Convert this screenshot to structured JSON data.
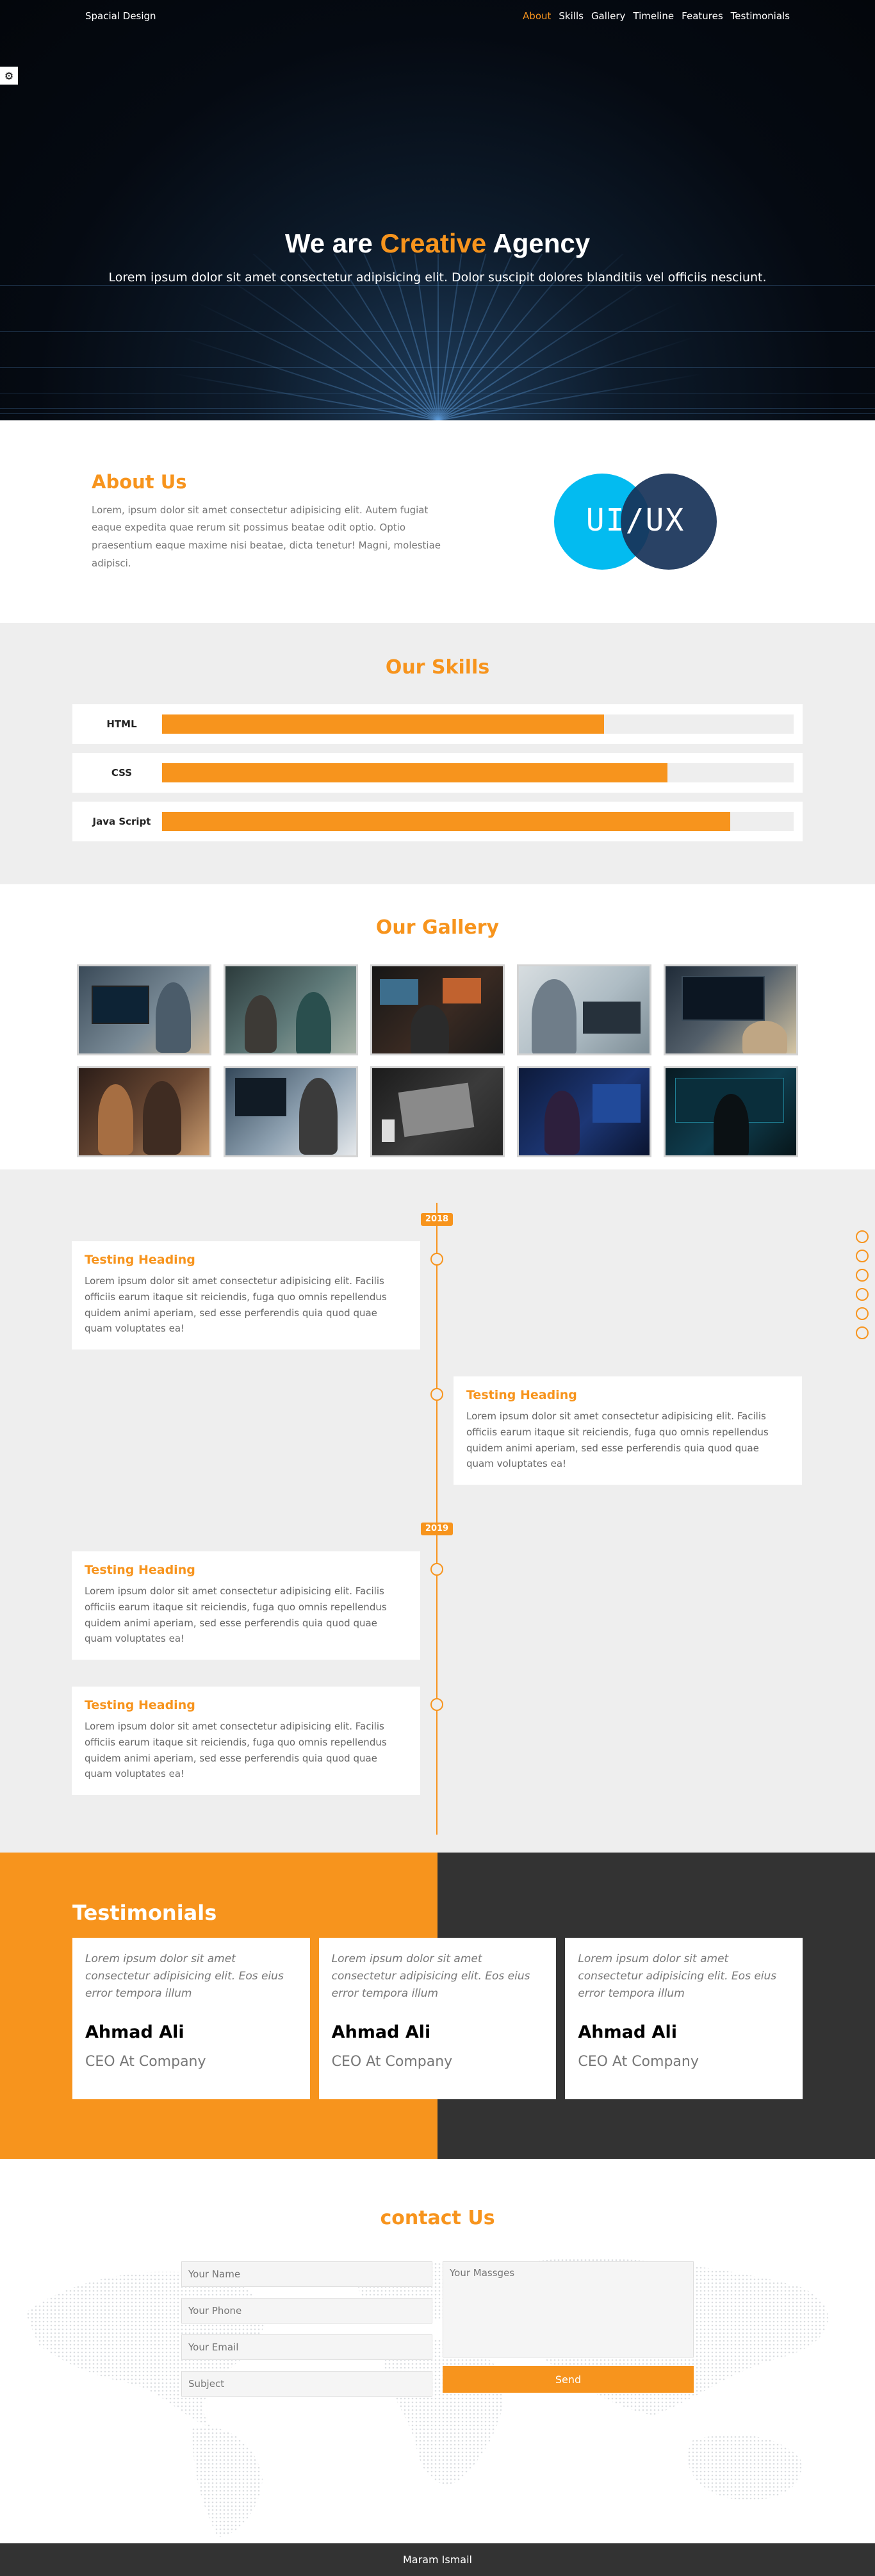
{
  "nav": {
    "logo": "Spacial Design",
    "links": [
      "About",
      "Skills",
      "Gallery",
      "Timeline",
      "Features",
      "Testimonials"
    ]
  },
  "settings": {
    "icon": "gear-icon"
  },
  "landing": {
    "title_before": "We are",
    "title_highlight": "Creative",
    "title_after": "Agency",
    "subtitle": "Lorem ipsum dolor sit amet consectetur adipisicing elit. Dolor suscipit dolores blanditiis vel officiis nesciunt."
  },
  "about": {
    "title": "About Us",
    "text": "Lorem, ipsum dolor sit amet consectetur adipisicing elit. Autem fugiat eaque expedita quae rerum sit possimus beatae odit optio. Optio praesentium eaque maxime nisi beatae, dicta tenetur! Magni, molestiae adipisci.",
    "image_text": "UI/UX"
  },
  "skills": {
    "title": "Our Skills",
    "items": [
      {
        "name": "HTML",
        "progress": 70
      },
      {
        "name": "CSS",
        "progress": 80
      },
      {
        "name": "Java Script",
        "progress": 90
      }
    ]
  },
  "gallery": {
    "title": "Our Gallery"
  },
  "timeline": {
    "years": [
      "2018",
      "2019"
    ],
    "items": [
      {
        "heading": "Testing Heading",
        "text": "Lorem ipsum dolor sit amet consectetur adipisicing elit. Facilis officiis earum itaque sit reiciendis, fuga quo omnis repellendus quidem animi aperiam, sed esse perferendis quia quod quae quam voluptates ea!"
      },
      {
        "heading": "Testing Heading",
        "text": "Lorem ipsum dolor sit amet consectetur adipisicing elit. Facilis officiis earum itaque sit reiciendis, fuga quo omnis repellendus quidem animi aperiam, sed esse perferendis quia quod quae quam voluptates ea!"
      },
      {
        "heading": "Testing Heading",
        "text": "Lorem ipsum dolor sit amet consectetur adipisicing elit. Facilis officiis earum itaque sit reiciendis, fuga quo omnis repellendus quidem animi aperiam, sed esse perferendis quia quod quae quam voluptates ea!"
      },
      {
        "heading": "Testing Heading",
        "text": "Lorem ipsum dolor sit amet consectetur adipisicing elit. Facilis officiis earum itaque sit reiciendis, fuga quo omnis repellendus quidem animi aperiam, sed esse perferendis quia quod quae quam voluptates ea!"
      }
    ]
  },
  "testimonials": {
    "title": "Testimonials",
    "items": [
      {
        "quote": "Lorem ipsum dolor sit amet consectetur adipisicing elit. Eos eius error tempora illum",
        "name": "Ahmad Ali",
        "title": "CEO At Company"
      },
      {
        "quote": "Lorem ipsum dolor sit amet consectetur adipisicing elit. Eos eius error tempora illum",
        "name": "Ahmad Ali",
        "title": "CEO At Company"
      },
      {
        "quote": "Lorem ipsum dolor sit amet consectetur adipisicing elit. Eos eius error tempora illum",
        "name": "Ahmad Ali",
        "title": "CEO At Company"
      }
    ]
  },
  "contact": {
    "title": "contact Us",
    "name_placeholder": "Your Name",
    "phone_placeholder": "Your Phone",
    "email_placeholder": "Your Email",
    "subject_placeholder": "Subject",
    "message_placeholder": "Your Massges",
    "send_label": "Send"
  },
  "footer": {
    "text": "Maram Ismail"
  },
  "colors": {
    "accent": "#f7941d",
    "dark": "#333333",
    "light": "#eeeeee"
  }
}
